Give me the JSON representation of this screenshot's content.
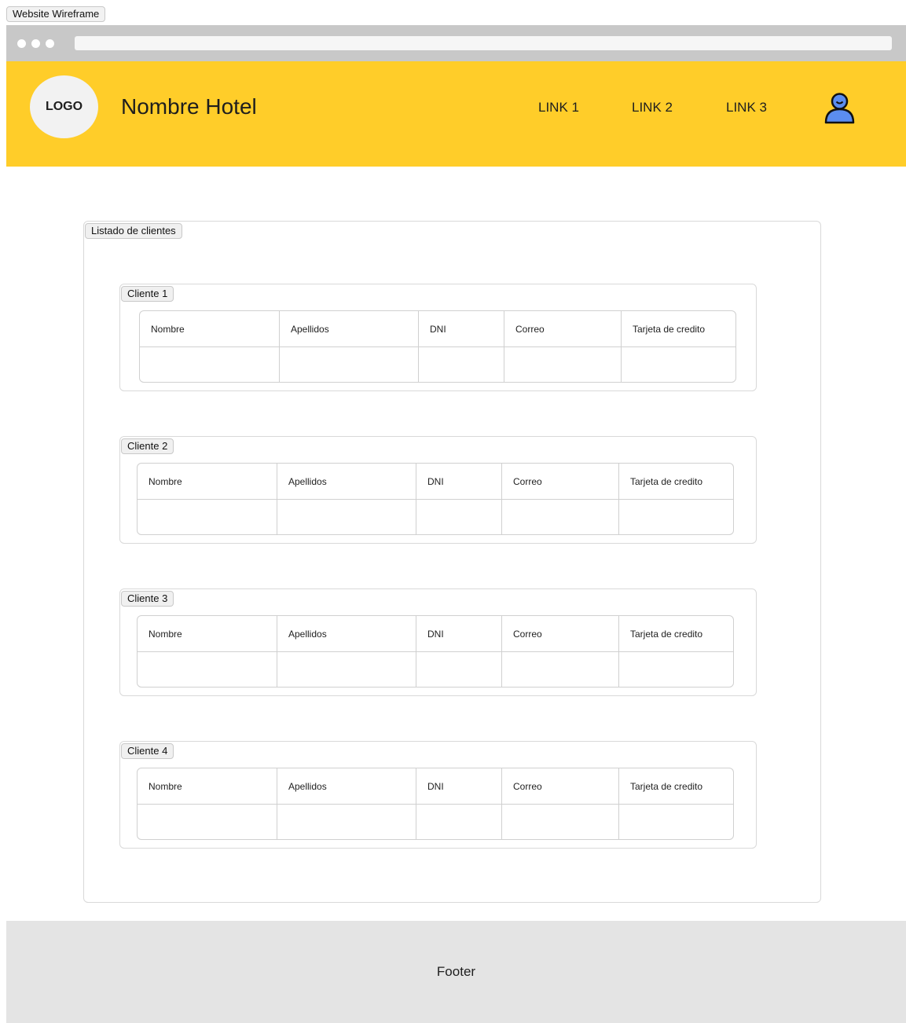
{
  "frame_label": "Website Wireframe",
  "header": {
    "logo": "LOGO",
    "hotel_name": "Nombre Hotel",
    "links": [
      "LINK 1",
      "LINK 2",
      "LINK 3"
    ],
    "user_icon": "user-icon",
    "background_color": "#ffcd29",
    "icon_color": "#5b8def"
  },
  "section": {
    "title": "Listado de clientes",
    "clients": [
      {
        "label": "Cliente 1",
        "columns": [
          "Nombre",
          "Apellidos",
          "DNI",
          "Correo",
          "Tarjeta de credito"
        ],
        "values": [
          "",
          "",
          "",
          "",
          ""
        ]
      },
      {
        "label": "Cliente 2",
        "columns": [
          "Nombre",
          "Apellidos",
          "DNI",
          "Correo",
          "Tarjeta de credito"
        ],
        "values": [
          "",
          "",
          "",
          "",
          ""
        ]
      },
      {
        "label": "Cliente 3",
        "columns": [
          "Nombre",
          "Apellidos",
          "DNI",
          "Correo",
          "Tarjeta de credito"
        ],
        "values": [
          "",
          "",
          "",
          "",
          ""
        ]
      },
      {
        "label": "Cliente 4",
        "columns": [
          "Nombre",
          "Apellidos",
          "DNI",
          "Correo",
          "Tarjeta de credito"
        ],
        "values": [
          "",
          "",
          "",
          "",
          ""
        ]
      }
    ]
  },
  "footer": {
    "text": "Footer"
  }
}
